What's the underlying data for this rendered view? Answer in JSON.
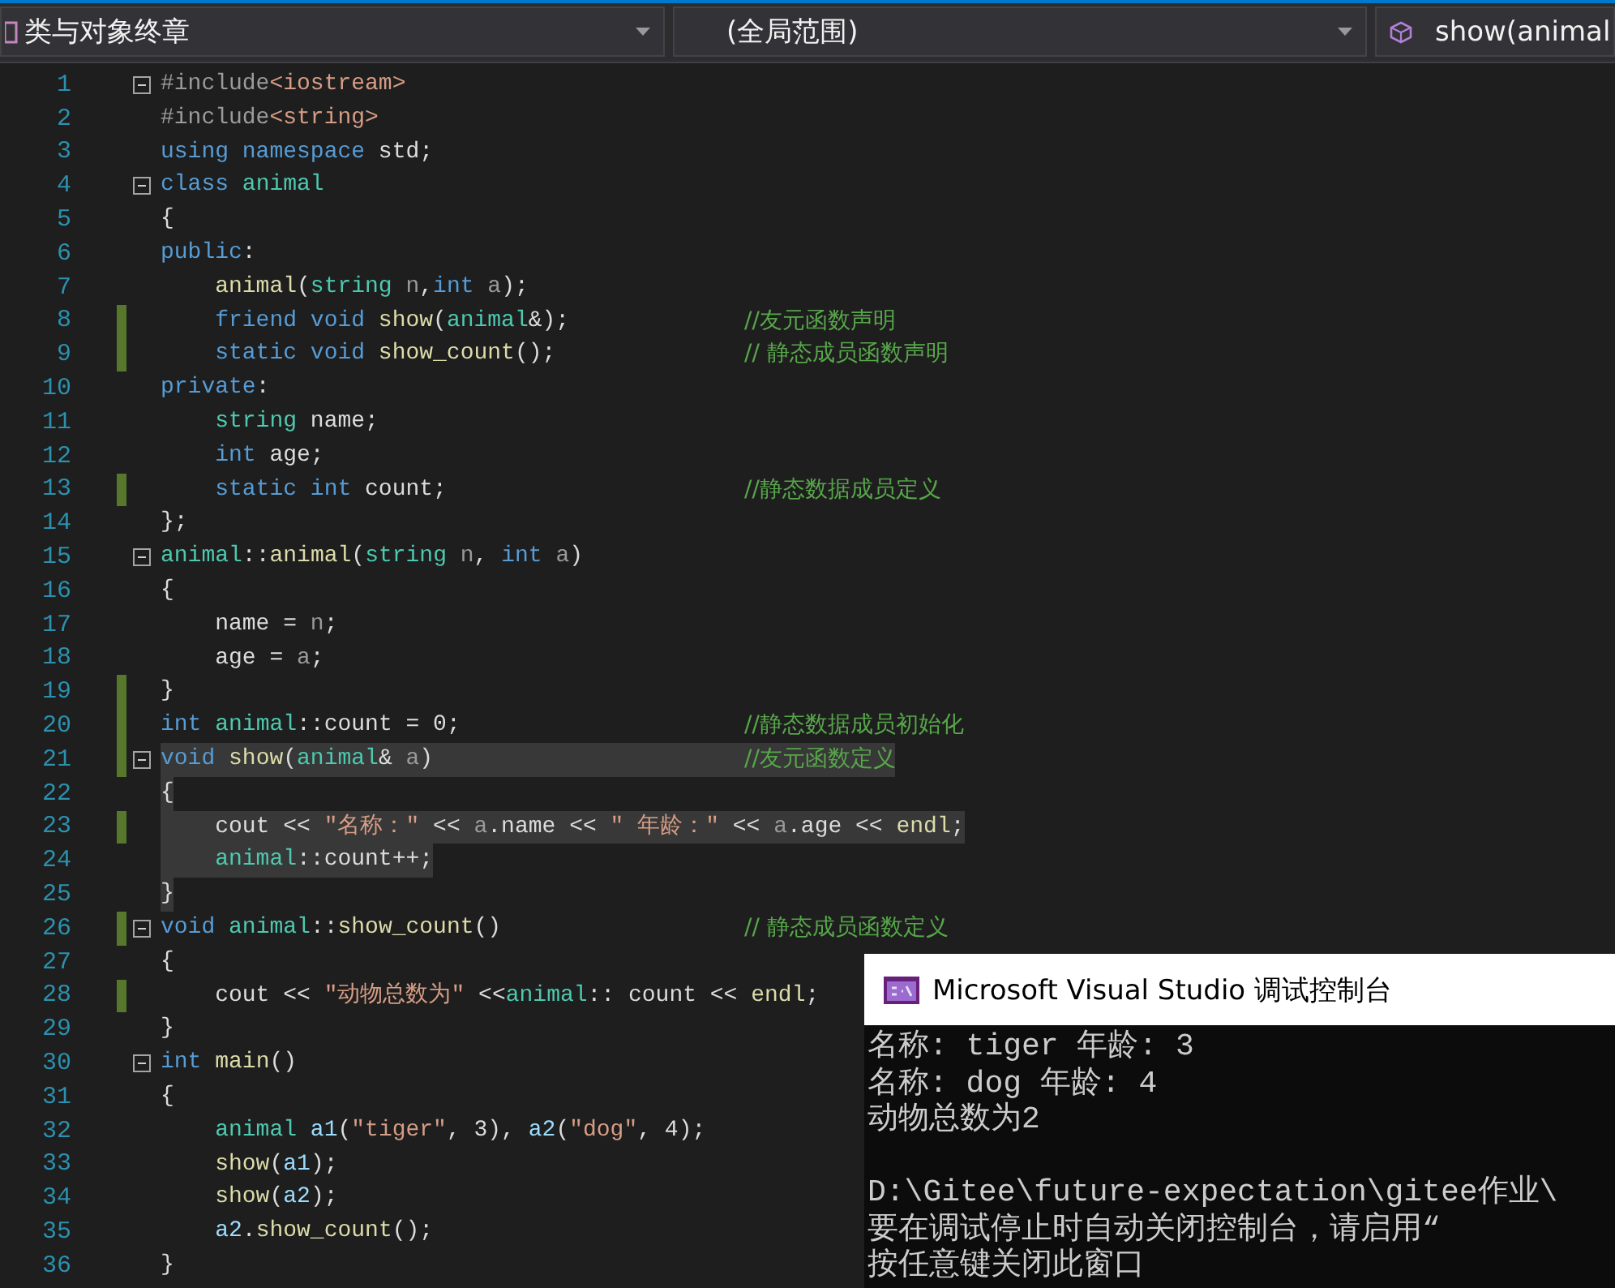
{
  "nav_bar": {
    "project": "类与对象终章",
    "scope": "(全局范围)",
    "member": "show(animal"
  },
  "lines": [
    {
      "number": "1",
      "fold": true,
      "changed": false,
      "selected": false,
      "code": [
        {
          "kind": "pp",
          "text": "#include"
        },
        {
          "kind": "str",
          "text": "<iostream>"
        }
      ]
    },
    {
      "number": "2",
      "fold": false,
      "changed": false,
      "selected": false,
      "code": [
        {
          "kind": "pp",
          "text": "#include"
        },
        {
          "kind": "str",
          "text": "<string>"
        }
      ]
    },
    {
      "number": "3",
      "fold": false,
      "changed": false,
      "selected": false,
      "code": [
        {
          "kind": "kw",
          "text": "using namespace"
        },
        {
          "kind": "p",
          "text": " std;"
        }
      ]
    },
    {
      "number": "4",
      "fold": true,
      "changed": false,
      "selected": false,
      "code": [
        {
          "kind": "kw",
          "text": "class "
        },
        {
          "kind": "type",
          "text": "animal"
        }
      ]
    },
    {
      "number": "5",
      "fold": false,
      "changed": false,
      "selected": false,
      "code": [
        {
          "kind": "p",
          "text": "{"
        }
      ]
    },
    {
      "number": "6",
      "fold": false,
      "changed": false,
      "selected": false,
      "code": [
        {
          "kind": "kw",
          "text": "public"
        },
        {
          "kind": "p",
          "text": ":"
        }
      ]
    },
    {
      "number": "7",
      "fold": false,
      "changed": false,
      "selected": false,
      "code": [
        {
          "kind": "fn",
          "text": "    animal"
        },
        {
          "kind": "p",
          "text": "("
        },
        {
          "kind": "type",
          "text": "string "
        },
        {
          "kind": "param",
          "text": "n"
        },
        {
          "kind": "p",
          "text": ","
        },
        {
          "kind": "kw",
          "text": "int "
        },
        {
          "kind": "param",
          "text": "a"
        },
        {
          "kind": "p",
          "text": ");"
        }
      ]
    },
    {
      "number": "8",
      "fold": false,
      "changed": true,
      "selected": false,
      "code": [
        {
          "kind": "kw",
          "text": "    friend void "
        },
        {
          "kind": "fn",
          "text": "show"
        },
        {
          "kind": "p",
          "text": "("
        },
        {
          "kind": "type",
          "text": "animal"
        },
        {
          "kind": "p",
          "text": "&);"
        }
      ],
      "comment": "//友元函数声明"
    },
    {
      "number": "9",
      "fold": false,
      "changed": true,
      "selected": false,
      "code": [
        {
          "kind": "kw",
          "text": "    static void "
        },
        {
          "kind": "fn",
          "text": "show_count"
        },
        {
          "kind": "p",
          "text": "();"
        }
      ],
      "comment": "// 静态成员函数声明"
    },
    {
      "number": "10",
      "fold": false,
      "changed": false,
      "selected": false,
      "code": [
        {
          "kind": "kw",
          "text": "private"
        },
        {
          "kind": "p",
          "text": ":"
        }
      ]
    },
    {
      "number": "11",
      "fold": false,
      "changed": false,
      "selected": false,
      "code": [
        {
          "kind": "type",
          "text": "    string"
        },
        {
          "kind": "p",
          "text": " name;"
        }
      ]
    },
    {
      "number": "12",
      "fold": false,
      "changed": false,
      "selected": false,
      "code": [
        {
          "kind": "kw",
          "text": "    int"
        },
        {
          "kind": "p",
          "text": " age;"
        }
      ]
    },
    {
      "number": "13",
      "fold": false,
      "changed": true,
      "selected": false,
      "code": [
        {
          "kind": "kw",
          "text": "    static int"
        },
        {
          "kind": "p",
          "text": " count;"
        }
      ],
      "comment": "//静态数据成员定义"
    },
    {
      "number": "14",
      "fold": false,
      "changed": false,
      "selected": false,
      "code": [
        {
          "kind": "p",
          "text": "};"
        }
      ]
    },
    {
      "number": "15",
      "fold": true,
      "changed": false,
      "selected": false,
      "code": [
        {
          "kind": "type",
          "text": "animal"
        },
        {
          "kind": "p",
          "text": "::"
        },
        {
          "kind": "fn",
          "text": "animal"
        },
        {
          "kind": "p",
          "text": "("
        },
        {
          "kind": "type",
          "text": "string "
        },
        {
          "kind": "param",
          "text": "n"
        },
        {
          "kind": "p",
          "text": ", "
        },
        {
          "kind": "kw",
          "text": "int "
        },
        {
          "kind": "param",
          "text": "a"
        },
        {
          "kind": "p",
          "text": ")"
        }
      ]
    },
    {
      "number": "16",
      "fold": false,
      "changed": false,
      "selected": false,
      "code": [
        {
          "kind": "p",
          "text": "{"
        }
      ]
    },
    {
      "number": "17",
      "fold": false,
      "changed": false,
      "selected": false,
      "code": [
        {
          "kind": "p",
          "text": "    name = "
        },
        {
          "kind": "param",
          "text": "n"
        },
        {
          "kind": "p",
          "text": ";"
        }
      ]
    },
    {
      "number": "18",
      "fold": false,
      "changed": false,
      "selected": false,
      "code": [
        {
          "kind": "p",
          "text": "    age = "
        },
        {
          "kind": "param",
          "text": "a"
        },
        {
          "kind": "p",
          "text": ";"
        }
      ]
    },
    {
      "number": "19",
      "fold": false,
      "changed": true,
      "selected": false,
      "code": [
        {
          "kind": "p",
          "text": "}"
        }
      ]
    },
    {
      "number": "20",
      "fold": false,
      "changed": true,
      "selected": false,
      "code": [
        {
          "kind": "kw",
          "text": "int "
        },
        {
          "kind": "type",
          "text": "animal"
        },
        {
          "kind": "p",
          "text": "::count = 0;"
        }
      ],
      "comment": "//静态数据成员初始化"
    },
    {
      "number": "21",
      "fold": true,
      "changed": true,
      "selected": true,
      "code": [
        {
          "kind": "kw",
          "text": "void "
        },
        {
          "kind": "fn",
          "text": "show"
        },
        {
          "kind": "p",
          "text": "("
        },
        {
          "kind": "type",
          "text": "animal"
        },
        {
          "kind": "p",
          "text": "& "
        },
        {
          "kind": "param",
          "text": "a"
        },
        {
          "kind": "p",
          "text": ")"
        }
      ],
      "comment": "//友元函数定义"
    },
    {
      "number": "22",
      "fold": false,
      "changed": false,
      "selected": true,
      "code": [
        {
          "kind": "p",
          "text": "{"
        }
      ]
    },
    {
      "number": "23",
      "fold": false,
      "changed": true,
      "selected": true,
      "code": [
        {
          "kind": "p",
          "text": "    cout << "
        },
        {
          "kind": "str",
          "text": "\"名称：\""
        },
        {
          "kind": "p",
          "text": " << "
        },
        {
          "kind": "param",
          "text": "a"
        },
        {
          "kind": "p",
          "text": ".name << "
        },
        {
          "kind": "str",
          "text": "\" 年龄：\""
        },
        {
          "kind": "p",
          "text": " << "
        },
        {
          "kind": "param",
          "text": "a"
        },
        {
          "kind": "p",
          "text": ".age << "
        },
        {
          "kind": "fn",
          "text": "endl"
        },
        {
          "kind": "p",
          "text": ";"
        }
      ]
    },
    {
      "number": "24",
      "fold": false,
      "changed": false,
      "selected": true,
      "code": [
        {
          "kind": "type",
          "text": "    animal"
        },
        {
          "kind": "p",
          "text": "::count++;"
        }
      ]
    },
    {
      "number": "25",
      "fold": false,
      "changed": false,
      "selected": true,
      "code": [
        {
          "kind": "p",
          "text": "}"
        }
      ]
    },
    {
      "number": "26",
      "fold": true,
      "changed": true,
      "selected": false,
      "code": [
        {
          "kind": "kw",
          "text": "void "
        },
        {
          "kind": "type",
          "text": "animal"
        },
        {
          "kind": "p",
          "text": "::"
        },
        {
          "kind": "fn",
          "text": "show_count"
        },
        {
          "kind": "p",
          "text": "()"
        }
      ],
      "comment": "// 静态成员函数定义"
    },
    {
      "number": "27",
      "fold": false,
      "changed": false,
      "selected": false,
      "code": [
        {
          "kind": "p",
          "text": "{"
        }
      ]
    },
    {
      "number": "28",
      "fold": false,
      "changed": true,
      "selected": false,
      "code": [
        {
          "kind": "p",
          "text": "    cout << "
        },
        {
          "kind": "str",
          "text": "\"动物总数为\""
        },
        {
          "kind": "p",
          "text": " <<"
        },
        {
          "kind": "type",
          "text": "animal"
        },
        {
          "kind": "p",
          "text": ":: count << "
        },
        {
          "kind": "fn",
          "text": "endl"
        },
        {
          "kind": "p",
          "text": ";"
        }
      ]
    },
    {
      "number": "29",
      "fold": false,
      "changed": false,
      "selected": false,
      "code": [
        {
          "kind": "p",
          "text": "}"
        }
      ]
    },
    {
      "number": "30",
      "fold": true,
      "changed": false,
      "selected": false,
      "code": [
        {
          "kind": "kw",
          "text": "int "
        },
        {
          "kind": "fn",
          "text": "main"
        },
        {
          "kind": "p",
          "text": "()"
        }
      ]
    },
    {
      "number": "31",
      "fold": false,
      "changed": false,
      "selected": false,
      "code": [
        {
          "kind": "p",
          "text": "{"
        }
      ]
    },
    {
      "number": "32",
      "fold": false,
      "changed": false,
      "selected": false,
      "code": [
        {
          "kind": "type",
          "text": "    animal "
        },
        {
          "kind": "var",
          "text": "a1"
        },
        {
          "kind": "p",
          "text": "("
        },
        {
          "kind": "str",
          "text": "\"tiger\""
        },
        {
          "kind": "p",
          "text": ", 3), "
        },
        {
          "kind": "var",
          "text": "a2"
        },
        {
          "kind": "p",
          "text": "("
        },
        {
          "kind": "str",
          "text": "\"dog\""
        },
        {
          "kind": "p",
          "text": ", 4);"
        }
      ]
    },
    {
      "number": "33",
      "fold": false,
      "changed": false,
      "selected": false,
      "code": [
        {
          "kind": "fn",
          "text": "    show"
        },
        {
          "kind": "p",
          "text": "("
        },
        {
          "kind": "var",
          "text": "a1"
        },
        {
          "kind": "p",
          "text": ");"
        }
      ]
    },
    {
      "number": "34",
      "fold": false,
      "changed": false,
      "selected": false,
      "code": [
        {
          "kind": "fn",
          "text": "    show"
        },
        {
          "kind": "p",
          "text": "("
        },
        {
          "kind": "var",
          "text": "a2"
        },
        {
          "kind": "p",
          "text": ");"
        }
      ]
    },
    {
      "number": "35",
      "fold": false,
      "changed": false,
      "selected": false,
      "code": [
        {
          "kind": "var",
          "text": "    a2"
        },
        {
          "kind": "p",
          "text": "."
        },
        {
          "kind": "fn",
          "text": "show_count"
        },
        {
          "kind": "p",
          "text": "();"
        }
      ]
    },
    {
      "number": "36",
      "fold": false,
      "changed": false,
      "selected": false,
      "code": [
        {
          "kind": "p",
          "text": "}"
        }
      ]
    }
  ],
  "console": {
    "title": "Microsoft Visual Studio 调试控制台",
    "output": [
      "名称: tiger 年龄: 3",
      "名称: dog 年龄: 4",
      "动物总数为2",
      "D:\\Gitee\\future-expectation\\gitee作业\\",
      "要在调试停止时自动关闭控制台，请启用“",
      "按任意键关闭此窗口"
    ]
  }
}
